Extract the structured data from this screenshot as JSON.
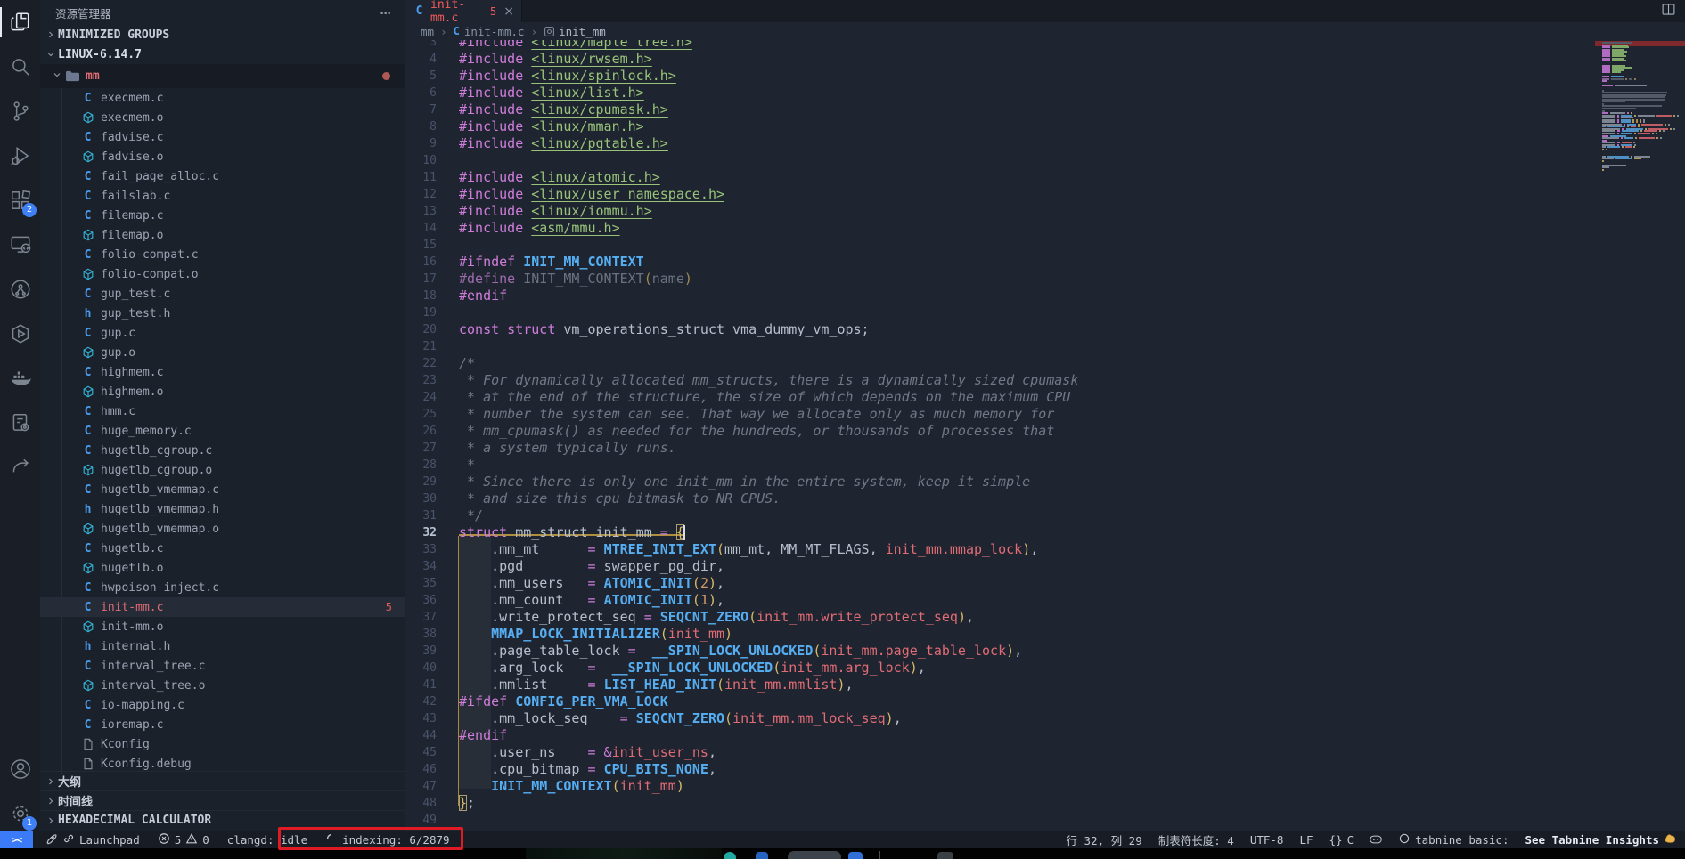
{
  "activity_bar": {
    "items": [
      {
        "icon": "explorer-icon",
        "active": true
      },
      {
        "icon": "search-icon"
      },
      {
        "icon": "source-control-icon"
      },
      {
        "icon": "run-debug-icon"
      },
      {
        "icon": "extensions-icon",
        "badge": "2"
      },
      {
        "icon": "remote-explorer-icon"
      },
      {
        "icon": "commit-graph-icon"
      },
      {
        "icon": "cmake-icon"
      },
      {
        "icon": "docker-icon"
      },
      {
        "icon": "project-config-icon"
      },
      {
        "icon": "redo-arrow-icon"
      }
    ],
    "bottom": [
      {
        "icon": "account-icon"
      },
      {
        "icon": "settings-gear-icon",
        "badge": "1"
      }
    ]
  },
  "sidebar": {
    "title": "资源管理器",
    "title_menu": "⋯",
    "minimized_groups_label": "MINIMIZED GROUPS",
    "workspace_label": "LINUX-6.14.7",
    "folder_name": "mm",
    "files": [
      {
        "name": "execmem.c",
        "icon": "c"
      },
      {
        "name": "execmem.o",
        "icon": "o"
      },
      {
        "name": "fadvise.c",
        "icon": "c"
      },
      {
        "name": "fadvise.o",
        "icon": "o"
      },
      {
        "name": "fail_page_alloc.c",
        "icon": "c"
      },
      {
        "name": "failslab.c",
        "icon": "c"
      },
      {
        "name": "filemap.c",
        "icon": "c"
      },
      {
        "name": "filemap.o",
        "icon": "o"
      },
      {
        "name": "folio-compat.c",
        "icon": "c"
      },
      {
        "name": "folio-compat.o",
        "icon": "o"
      },
      {
        "name": "gup_test.c",
        "icon": "c"
      },
      {
        "name": "gup_test.h",
        "icon": "h"
      },
      {
        "name": "gup.c",
        "icon": "c"
      },
      {
        "name": "gup.o",
        "icon": "o"
      },
      {
        "name": "highmem.c",
        "icon": "c"
      },
      {
        "name": "highmem.o",
        "icon": "o"
      },
      {
        "name": "hmm.c",
        "icon": "c"
      },
      {
        "name": "huge_memory.c",
        "icon": "c"
      },
      {
        "name": "hugetlb_cgroup.c",
        "icon": "c"
      },
      {
        "name": "hugetlb_cgroup.o",
        "icon": "o"
      },
      {
        "name": "hugetlb_vmemmap.c",
        "icon": "c"
      },
      {
        "name": "hugetlb_vmemmap.h",
        "icon": "h"
      },
      {
        "name": "hugetlb_vmemmap.o",
        "icon": "o"
      },
      {
        "name": "hugetlb.c",
        "icon": "c"
      },
      {
        "name": "hugetlb.o",
        "icon": "o"
      },
      {
        "name": "hwpoison-inject.c",
        "icon": "c"
      },
      {
        "name": "init-mm.c",
        "icon": "c",
        "selected": true,
        "badge": "5"
      },
      {
        "name": "init-mm.o",
        "icon": "o"
      },
      {
        "name": "internal.h",
        "icon": "h"
      },
      {
        "name": "interval_tree.c",
        "icon": "c"
      },
      {
        "name": "interval_tree.o",
        "icon": "o"
      },
      {
        "name": "io-mapping.c",
        "icon": "c"
      },
      {
        "name": "ioremap.c",
        "icon": "c"
      },
      {
        "name": "Kconfig",
        "icon": "file"
      },
      {
        "name": "Kconfig.debug",
        "icon": "file"
      }
    ],
    "bottom_sections": [
      {
        "label": "大纲"
      },
      {
        "label": "时间线"
      },
      {
        "label": "HEXADECIMAL CALCULATOR"
      }
    ]
  },
  "editor": {
    "tab": {
      "label": "init-mm.c",
      "badge": "5",
      "close": "×"
    },
    "breadcrumb": {
      "root": "mm",
      "file": "init-mm.c",
      "symbol": "init_mm"
    },
    "cursor": {
      "line": 32,
      "col": 29
    },
    "code_lines": [
      {
        "n": 3,
        "t": [
          [
            "k",
            "#include "
          ],
          [
            "i",
            "<linux/maple_tree.h>"
          ]
        ]
      },
      {
        "n": 4,
        "t": [
          [
            "k",
            "#include "
          ],
          [
            "i",
            "<linux/rwsem.h>"
          ]
        ]
      },
      {
        "n": 5,
        "t": [
          [
            "k",
            "#include "
          ],
          [
            "i",
            "<linux/spinlock.h>"
          ]
        ]
      },
      {
        "n": 6,
        "t": [
          [
            "k",
            "#include "
          ],
          [
            "i",
            "<linux/list.h>"
          ]
        ]
      },
      {
        "n": 7,
        "t": [
          [
            "k",
            "#include "
          ],
          [
            "i",
            "<linux/cpumask.h>"
          ]
        ]
      },
      {
        "n": 8,
        "t": [
          [
            "k",
            "#include "
          ],
          [
            "i",
            "<linux/mman.h>"
          ]
        ]
      },
      {
        "n": 9,
        "t": [
          [
            "k",
            "#include "
          ],
          [
            "i",
            "<linux/pgtable.h>"
          ]
        ]
      },
      {
        "n": 10,
        "t": []
      },
      {
        "n": 11,
        "t": [
          [
            "k",
            "#include "
          ],
          [
            "i",
            "<linux/atomic.h>"
          ]
        ]
      },
      {
        "n": 12,
        "t": [
          [
            "k",
            "#include "
          ],
          [
            "i",
            "<linux/user_namespace.h>"
          ]
        ]
      },
      {
        "n": 13,
        "t": [
          [
            "k",
            "#include "
          ],
          [
            "i",
            "<linux/iommu.h>"
          ]
        ]
      },
      {
        "n": 14,
        "t": [
          [
            "k",
            "#include "
          ],
          [
            "i",
            "<asm/mmu.h>"
          ]
        ]
      },
      {
        "n": 15,
        "t": []
      },
      {
        "n": 16,
        "t": [
          [
            "k",
            "#ifndef "
          ],
          [
            "m",
            "INIT_MM_CONTEXT"
          ]
        ]
      },
      {
        "n": 17,
        "t": [
          [
            "kd",
            "#define "
          ],
          [
            "d",
            "INIT_MM_CONTEXT"
          ],
          [
            "yd",
            "("
          ],
          [
            "d",
            "name"
          ],
          [
            "yd",
            ")"
          ]
        ]
      },
      {
        "n": 18,
        "t": [
          [
            "k",
            "#endif"
          ]
        ]
      },
      {
        "n": 19,
        "t": []
      },
      {
        "n": 20,
        "t": [
          [
            "k",
            "const struct "
          ],
          [
            "t",
            "vm_operations_struct vma_dummy_vm_ops;"
          ]
        ]
      },
      {
        "n": 21,
        "t": []
      },
      {
        "n": 22,
        "t": [
          [
            "c",
            "/*"
          ]
        ]
      },
      {
        "n": 23,
        "t": [
          [
            "c",
            " * For dynamically allocated mm_structs, there is a dynamically sized cpumask"
          ]
        ]
      },
      {
        "n": 24,
        "t": [
          [
            "c",
            " * at the end of the structure, the size of which depends on the maximum CPU"
          ]
        ]
      },
      {
        "n": 25,
        "t": [
          [
            "c",
            " * number the system can see. That way we allocate only as much memory for"
          ]
        ]
      },
      {
        "n": 26,
        "t": [
          [
            "c",
            " * mm_cpumask() as needed for the hundreds, or thousands of processes that"
          ]
        ]
      },
      {
        "n": 27,
        "t": [
          [
            "c",
            " * a system typically runs."
          ]
        ]
      },
      {
        "n": 28,
        "t": [
          [
            "c",
            " *"
          ]
        ]
      },
      {
        "n": 29,
        "t": [
          [
            "c",
            " * Since there is only one init_mm in the entire system, keep it simple"
          ]
        ]
      },
      {
        "n": 30,
        "t": [
          [
            "c",
            " * and size this cpu_bitmask to NR_CPUS."
          ]
        ]
      },
      {
        "n": 31,
        "t": [
          [
            "c",
            " */"
          ]
        ]
      },
      {
        "n": 32,
        "t": [
          [
            "k",
            "struct "
          ],
          [
            "t",
            "mm_struct init_mm "
          ],
          [
            "k",
            "= "
          ],
          [
            "y bm",
            "{"
          ]
        ]
      },
      {
        "n": 33,
        "t": [
          [
            "t",
            "    .mm_mt      "
          ],
          [
            "k",
            "= "
          ],
          [
            "m",
            "MTREE_INIT_EXT"
          ],
          [
            "y",
            "("
          ],
          [
            "t",
            "mm_mt, MM_MT_FLAGS, "
          ],
          [
            "r",
            "init_mm.mmap_lock"
          ],
          [
            "y",
            ")"
          ],
          [
            "t",
            ","
          ]
        ]
      },
      {
        "n": 34,
        "t": [
          [
            "t",
            "    .pgd        "
          ],
          [
            "k",
            "= "
          ],
          [
            "t",
            "swapper_pg_dir,"
          ]
        ]
      },
      {
        "n": 35,
        "t": [
          [
            "t",
            "    .mm_users   "
          ],
          [
            "k",
            "= "
          ],
          [
            "m",
            "ATOMIC_INIT"
          ],
          [
            "y",
            "("
          ],
          [
            "n",
            "2"
          ],
          [
            "y",
            ")"
          ],
          [
            "t",
            ","
          ]
        ]
      },
      {
        "n": 36,
        "t": [
          [
            "t",
            "    .mm_count   "
          ],
          [
            "k",
            "= "
          ],
          [
            "m",
            "ATOMIC_INIT"
          ],
          [
            "y",
            "("
          ],
          [
            "n",
            "1"
          ],
          [
            "y",
            ")"
          ],
          [
            "t",
            ","
          ]
        ]
      },
      {
        "n": 37,
        "t": [
          [
            "t",
            "    .write_protect_seq "
          ],
          [
            "k",
            "= "
          ],
          [
            "m",
            "SEQCNT_ZERO"
          ],
          [
            "y",
            "("
          ],
          [
            "r",
            "init_mm.write_protect_seq"
          ],
          [
            "y",
            ")"
          ],
          [
            "t",
            ","
          ]
        ]
      },
      {
        "n": 38,
        "t": [
          [
            "t",
            "    "
          ],
          [
            "m",
            "MMAP_LOCK_INITIALIZER"
          ],
          [
            "y",
            "("
          ],
          [
            "r",
            "init_mm"
          ],
          [
            "y",
            ")"
          ]
        ]
      },
      {
        "n": 39,
        "t": [
          [
            "t",
            "    .page_table_lock "
          ],
          [
            "k",
            "=  "
          ],
          [
            "m",
            "__SPIN_LOCK_UNLOCKED"
          ],
          [
            "y",
            "("
          ],
          [
            "r",
            "init_mm.page_table_lock"
          ],
          [
            "y",
            ")"
          ],
          [
            "t",
            ","
          ]
        ]
      },
      {
        "n": 40,
        "t": [
          [
            "t",
            "    .arg_lock   "
          ],
          [
            "k",
            "=  "
          ],
          [
            "m",
            "__SPIN_LOCK_UNLOCKED"
          ],
          [
            "y",
            "("
          ],
          [
            "r",
            "init_mm.arg_lock"
          ],
          [
            "y",
            ")"
          ],
          [
            "t",
            ","
          ]
        ]
      },
      {
        "n": 41,
        "t": [
          [
            "t",
            "    .mmlist     "
          ],
          [
            "k",
            "= "
          ],
          [
            "m",
            "LIST_HEAD_INIT"
          ],
          [
            "y",
            "("
          ],
          [
            "r",
            "init_mm.mmlist"
          ],
          [
            "y",
            ")"
          ],
          [
            "t",
            ","
          ]
        ]
      },
      {
        "n": 42,
        "t": [
          [
            "k",
            "#ifdef "
          ],
          [
            "m",
            "CONFIG_PER_VMA_LOCK"
          ]
        ]
      },
      {
        "n": 43,
        "t": [
          [
            "t",
            "    .mm_lock_seq    "
          ],
          [
            "k",
            "= "
          ],
          [
            "m",
            "SEQCNT_ZERO"
          ],
          [
            "y",
            "("
          ],
          [
            "r",
            "init_mm.mm_lock_seq"
          ],
          [
            "y",
            ")"
          ],
          [
            "t",
            ","
          ]
        ]
      },
      {
        "n": 44,
        "t": [
          [
            "k",
            "#endif"
          ]
        ]
      },
      {
        "n": 45,
        "t": [
          [
            "t",
            "    .user_ns    "
          ],
          [
            "k",
            "= &"
          ],
          [
            "r",
            "init_user_ns"
          ],
          [
            "t",
            ","
          ]
        ]
      },
      {
        "n": 46,
        "t": [
          [
            "t",
            "    .cpu_bitmap "
          ],
          [
            "k",
            "= "
          ],
          [
            "m",
            "CPU_BITS_NONE"
          ],
          [
            "t",
            ","
          ]
        ]
      },
      {
        "n": 47,
        "t": [
          [
            "t",
            "    "
          ],
          [
            "m",
            "INIT_MM_CONTEXT"
          ],
          [
            "y",
            "("
          ],
          [
            "r",
            "init_mm"
          ],
          [
            "y",
            ")"
          ]
        ]
      },
      {
        "n": 48,
        "t": [
          [
            "y bm",
            "}"
          ],
          [
            "t",
            ";"
          ]
        ]
      },
      {
        "n": 49,
        "t": []
      }
    ]
  },
  "status_bar": {
    "remote_glyph": "><",
    "launchpad": "Launchpad",
    "errors": "5",
    "warnings": "0",
    "clangd": "clangd: idle",
    "indexing": "indexing: 6/2879",
    "line_col": "行 32, 列 29",
    "tab_size": "制表符长度: 4",
    "encoding": "UTF-8",
    "eol": "LF",
    "language_braces": "{}",
    "language": "C",
    "tabnine": "tabnine basic:",
    "tabnine_insights": "See Tabnine Insights"
  }
}
